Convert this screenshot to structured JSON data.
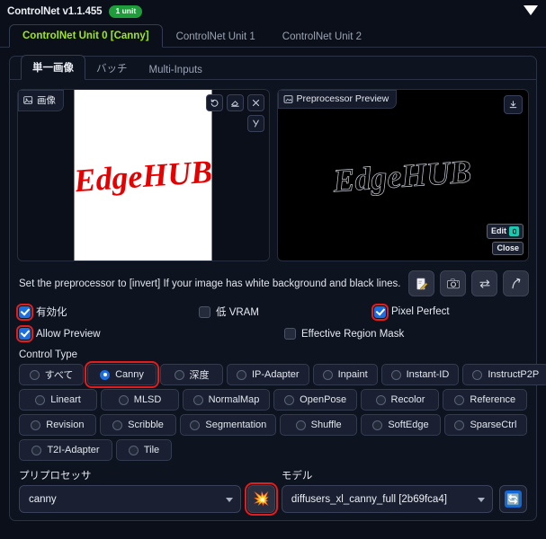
{
  "header": {
    "title": "ControlNet v1.1.455",
    "badge": "1 unit",
    "collapse_icon": "caret-down-icon"
  },
  "unit_tabs": [
    {
      "label": "ControlNet Unit 0 [Canny]",
      "active": true
    },
    {
      "label": "ControlNet Unit 1",
      "active": false
    },
    {
      "label": "ControlNet Unit 2",
      "active": false
    }
  ],
  "inner_tabs": [
    {
      "label": "単一画像",
      "active": true
    },
    {
      "label": "バッチ",
      "active": false
    },
    {
      "label": "Multi-Inputs",
      "active": false
    }
  ],
  "image_panel": {
    "label": "画像",
    "label_icon": "image-icon",
    "artwork_text": "EdgeHUB",
    "artwork_color": "#e60000",
    "tools": [
      {
        "name": "undo-icon",
        "title": "undo"
      },
      {
        "name": "eraser-icon",
        "title": "eraser"
      },
      {
        "name": "close-icon",
        "title": "remove"
      },
      {
        "name": "brush-icon",
        "title": "brush"
      }
    ]
  },
  "preview_panel": {
    "label": "Preprocessor Preview",
    "label_icon": "preview-image-icon",
    "download_icon": "download-icon",
    "artwork_text": "EdgeHUB",
    "edit_button": "Edit",
    "edit_icon": "photopea-icon",
    "close_button": "Close"
  },
  "hint": {
    "text": "Set the preprocessor to [invert] If your image has white background and black lines."
  },
  "action_buttons": [
    {
      "name": "open-new-canvas-button",
      "icon": "note-pencil-icon",
      "glyph": "📝"
    },
    {
      "name": "webcam-button",
      "icon": "camera-icon",
      "glyph": "📷"
    },
    {
      "name": "mirror-webcam-button",
      "icon": "swap-arrows-icon",
      "glyph": "⇄"
    },
    {
      "name": "send-dimensions-button",
      "icon": "curved-arrow-icon",
      "glyph": "↗"
    }
  ],
  "checkboxes": {
    "row1": [
      {
        "label": "有効化",
        "checked": true,
        "highlight": true,
        "name": "enable-checkbox"
      },
      {
        "label": "低 VRAM",
        "checked": false,
        "highlight": false,
        "name": "low-vram-checkbox"
      },
      {
        "label": "Pixel Perfect",
        "checked": true,
        "highlight": true,
        "name": "pixel-perfect-checkbox"
      }
    ],
    "row2": [
      {
        "label": "Allow Preview",
        "checked": true,
        "highlight": true,
        "name": "allow-preview-checkbox"
      },
      {
        "label": "Effective Region Mask",
        "checked": false,
        "highlight": false,
        "name": "effective-region-mask-checkbox"
      }
    ]
  },
  "control_type": {
    "label": "Control Type",
    "rows": [
      [
        {
          "label": "すべて",
          "selected": false,
          "highlight": false
        },
        {
          "label": "Canny",
          "selected": true,
          "highlight": true
        },
        {
          "label": "深度",
          "selected": false,
          "highlight": false
        },
        {
          "label": "IP-Adapter",
          "selected": false,
          "highlight": false
        },
        {
          "label": "Inpaint",
          "selected": false,
          "highlight": false
        },
        {
          "label": "Instant-ID",
          "selected": false,
          "highlight": false
        },
        {
          "label": "InstructP2P",
          "selected": false,
          "highlight": false
        }
      ],
      [
        {
          "label": "Lineart",
          "selected": false,
          "highlight": false
        },
        {
          "label": "MLSD",
          "selected": false,
          "highlight": false
        },
        {
          "label": "NormalMap",
          "selected": false,
          "highlight": false
        },
        {
          "label": "OpenPose",
          "selected": false,
          "highlight": false
        },
        {
          "label": "Recolor",
          "selected": false,
          "highlight": false
        },
        {
          "label": "Reference",
          "selected": false,
          "highlight": false
        }
      ],
      [
        {
          "label": "Revision",
          "selected": false,
          "highlight": false
        },
        {
          "label": "Scribble",
          "selected": false,
          "highlight": false
        },
        {
          "label": "Segmentation",
          "selected": false,
          "highlight": false
        },
        {
          "label": "Shuffle",
          "selected": false,
          "highlight": false
        },
        {
          "label": "SoftEdge",
          "selected": false,
          "highlight": false
        },
        {
          "label": "SparseCtrl",
          "selected": false,
          "highlight": false
        }
      ],
      [
        {
          "label": "T2I-Adapter",
          "selected": false,
          "highlight": false
        },
        {
          "label": "Tile",
          "selected": false,
          "highlight": false
        }
      ]
    ]
  },
  "bottom": {
    "preprocessor_label": "プリプロセッサ",
    "preprocessor_value": "canny",
    "run_preprocessor_icon": "explosion-icon",
    "run_preprocessor_glyph": "💥",
    "model_label": "モデル",
    "model_value": "diffusers_xl_canny_full [2b69fca4]",
    "refresh_icon": "refresh-icon",
    "refresh_glyph": "🔄"
  },
  "colors": {
    "background": "#0b0f19",
    "accent_green": "#9fe620",
    "badge_green": "#1f9d3a",
    "highlight_red": "#e11d1d",
    "checkbox_blue": "#1c6fe0",
    "refresh_blue": "#1569d6"
  }
}
